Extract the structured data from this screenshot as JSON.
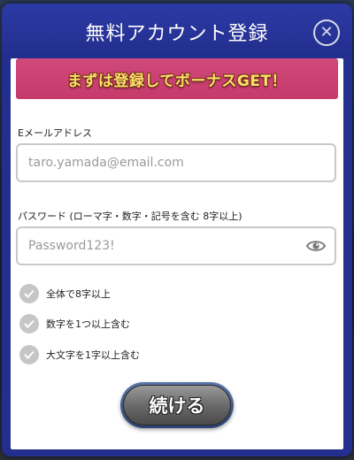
{
  "modal": {
    "title": "無料アカウント登録",
    "close_icon": "close-circle-icon"
  },
  "promo": {
    "text": "まずは登録してボーナスGET！",
    "background_color": "#c53a6b",
    "text_color": "#f6e26a"
  },
  "email": {
    "label": "Eメールアドレス",
    "placeholder": "taro.yamada@email.com",
    "value": ""
  },
  "password": {
    "label": "パスワード (ローマ字・数字・記号を含む 8字以上)",
    "placeholder": "Password123!",
    "value": "",
    "toggle_icon": "eye-icon"
  },
  "requirements": [
    {
      "text": "全体で8字以上",
      "icon": "check-icon"
    },
    {
      "text": "数字を1つ以上含む",
      "icon": "check-icon"
    },
    {
      "text": "大文字を1字以上含む",
      "icon": "check-icon"
    }
  ],
  "submit": {
    "label": "続ける"
  },
  "colors": {
    "header_bg": "#232f8f",
    "check_bg": "#c6c6c6"
  }
}
